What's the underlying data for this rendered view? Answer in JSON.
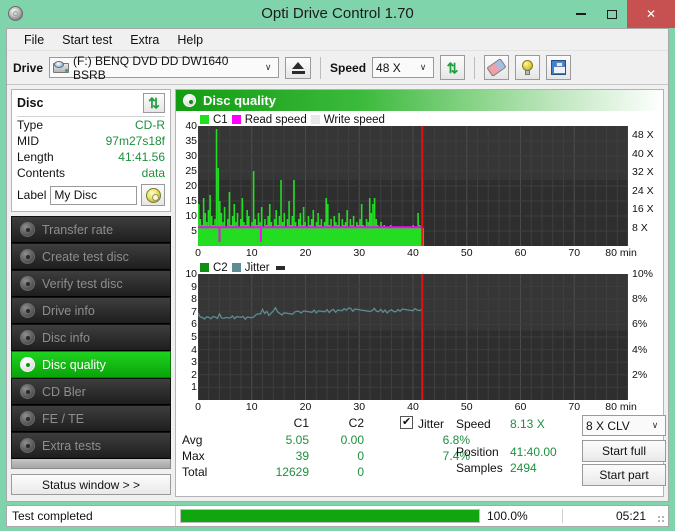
{
  "window": {
    "title": "Opti Drive Control 1.70",
    "icon": "cd-disc-icon",
    "controls": {
      "minimize": "–",
      "maximize": "□",
      "close": "✕"
    }
  },
  "menu": {
    "items": [
      "File",
      "Start test",
      "Extra",
      "Help"
    ]
  },
  "toolbar": {
    "drive_label": "Drive",
    "drive_value": "(F:)  BENQ DVD DD DW1640 BSRB",
    "eject_title": "Eject",
    "speed_label": "Speed",
    "speed_value": "48 X",
    "refresh_icon": "refresh-icon",
    "eraser_icon": "eraser-icon",
    "bulb_icon": "bulb-icon",
    "save_icon": "floppy-save-icon"
  },
  "disc_panel": {
    "title": "Disc",
    "refresh_icon": "refresh-icon",
    "rows": [
      {
        "key": "Type",
        "value": "CD-R"
      },
      {
        "key": "MID",
        "value": "97m27s18f"
      },
      {
        "key": "Length",
        "value": "41:41.56"
      },
      {
        "key": "Contents",
        "value": "data"
      }
    ],
    "label_key": "Label",
    "label_value": "My Disc",
    "label_button_icon": "cd-disc-icon"
  },
  "sidebar": {
    "items": [
      {
        "label": "Transfer rate",
        "active": false
      },
      {
        "label": "Create test disc",
        "active": false
      },
      {
        "label": "Verify test disc",
        "active": false
      },
      {
        "label": "Drive info",
        "active": false
      },
      {
        "label": "Disc info",
        "active": false
      },
      {
        "label": "Disc quality",
        "active": true
      },
      {
        "label": "CD Bler",
        "active": false
      },
      {
        "label": "FE / TE",
        "active": false
      },
      {
        "label": "Extra tests",
        "active": false
      }
    ],
    "status_window_button": "Status window > >"
  },
  "main": {
    "header_title": "Disc quality",
    "header_icon": "disc-quality-icon"
  },
  "stats": {
    "col_headers": [
      "C1",
      "C2"
    ],
    "row_labels": [
      "Avg",
      "Max",
      "Total"
    ],
    "c1": {
      "avg": "5.05",
      "max": "39",
      "total": "12629"
    },
    "c2": {
      "avg": "0.00",
      "max": "0",
      "total": "0"
    },
    "jitter_checkbox_checked": true,
    "jitter_label": "Jitter",
    "jitter_avg": "6.8%",
    "jitter_max": "7.4%",
    "speed_label": "Speed",
    "speed_value": "8.13 X",
    "position_label": "Position",
    "position_value": "41:40.00",
    "samples_label": "Samples",
    "samples_value": "2494",
    "write_strategy": "8 X CLV",
    "start_full_button": "Start full",
    "start_part_button": "Start part"
  },
  "statusbar": {
    "message": "Test completed",
    "progress_percent": "100.0%",
    "progress_value": 100,
    "elapsed": "05:21"
  },
  "colors": {
    "title_bar": "#7fd4ab",
    "close_button": "#c75050",
    "accent_green": "#0fa60f",
    "value_green": "#1f8f3f",
    "c1_green": "#22dd22",
    "read_speed_magenta": "#ff00ff",
    "write_speed_grey": "#e8e8e8",
    "c2_green": "#109010",
    "jitter_teal": "#5c8d92",
    "marker_red": "#ee1111",
    "plot_background": "#2b2b2b"
  },
  "chart_data": [
    {
      "type": "area",
      "name": "c1-error-chart",
      "title": "C1 errors / speed",
      "xlabel": "min",
      "ylabel": "C1",
      "xlim": [
        0,
        80
      ],
      "ylim": [
        0,
        40
      ],
      "xticks": [
        0,
        10,
        20,
        30,
        40,
        50,
        60,
        70,
        80
      ],
      "xticklabels": [
        "0",
        "10",
        "20",
        "30",
        "40",
        "50",
        "60",
        "70",
        "80 min"
      ],
      "yticks": [
        5,
        10,
        15,
        20,
        25,
        30,
        35,
        40
      ],
      "right_axis": {
        "label": "X",
        "ylim": [
          0,
          52
        ],
        "ticks": [
          8,
          16,
          24,
          32,
          40,
          48
        ],
        "ticklabels": [
          "8 X",
          "16 X",
          "24 X",
          "32 X",
          "40 X",
          "48 X"
        ]
      },
      "grid": true,
      "legend": [
        {
          "label": "C1",
          "color": "#22dd22"
        },
        {
          "label": "Read speed",
          "color": "#ff00ff"
        },
        {
          "label": "Write speed",
          "color": "#e8e8e8"
        }
      ],
      "data_end_x": 41.7,
      "marker_x": 41.7,
      "series": [
        {
          "name": "C1",
          "color": "#22dd22",
          "x": [
            0.0,
            0.3,
            0.6,
            0.9,
            1.2,
            1.5,
            1.8,
            2.1,
            2.4,
            2.7,
            3.0,
            3.3,
            3.6,
            3.9,
            4.2,
            4.5,
            4.8,
            5.1,
            5.4,
            5.7,
            6.0,
            6.3,
            6.6,
            6.9,
            7.2,
            7.5,
            7.8,
            8.1,
            8.4,
            8.7,
            9.0,
            9.3,
            9.6,
            9.9,
            10.2,
            10.5,
            10.8,
            11.1,
            11.4,
            11.7,
            12.0,
            12.3,
            12.6,
            12.9,
            13.2,
            13.5,
            13.8,
            14.1,
            14.4,
            14.7,
            15.0,
            15.3,
            15.6,
            15.9,
            16.2,
            16.5,
            16.8,
            17.1,
            17.4,
            17.7,
            18.0,
            18.3,
            18.6,
            18.9,
            19.2,
            19.5,
            19.8,
            20.1,
            20.4,
            20.7,
            21.0,
            21.3,
            21.6,
            21.9,
            22.2,
            22.5,
            22.8,
            23.1,
            23.4,
            23.7,
            24.0,
            24.3,
            24.6,
            24.9,
            25.2,
            25.5,
            25.8,
            26.1,
            26.4,
            26.7,
            27.0,
            27.3,
            27.6,
            27.9,
            28.2,
            28.5,
            28.8,
            29.1,
            29.4,
            29.7,
            30.0,
            30.3,
            30.6,
            30.9,
            31.2,
            31.5,
            31.8,
            32.1,
            32.4,
            32.7,
            33.0,
            33.3,
            33.6,
            33.9,
            34.2,
            34.5,
            34.8,
            35.1,
            35.4,
            35.7,
            36.0,
            36.3,
            36.6,
            36.9,
            37.2,
            37.5,
            37.8,
            38.1,
            38.4,
            38.7,
            39.0,
            39.3,
            39.6,
            39.9,
            40.2,
            40.5,
            40.8,
            41.1,
            41.4,
            41.7
          ],
          "values": [
            14,
            9,
            7,
            16,
            11,
            8,
            12,
            17,
            10,
            7,
            9,
            39,
            26,
            15,
            11,
            8,
            13,
            6,
            9,
            18,
            7,
            10,
            14,
            8,
            11,
            6,
            9,
            16,
            8,
            7,
            12,
            10,
            6,
            8,
            25,
            9,
            7,
            11,
            8,
            13,
            6,
            9,
            7,
            10,
            14,
            8,
            6,
            9,
            12,
            7,
            10,
            22,
            8,
            11,
            6,
            9,
            15,
            7,
            10,
            22,
            8,
            6,
            9,
            11,
            7,
            13,
            8,
            6,
            10,
            7,
            9,
            12,
            6,
            8,
            11,
            7,
            9,
            6,
            8,
            16,
            14,
            7,
            9,
            6,
            10,
            8,
            7,
            11,
            6,
            9,
            7,
            8,
            12,
            6,
            9,
            7,
            10,
            6,
            8,
            7,
            9,
            14,
            7,
            6,
            9,
            8,
            16,
            11,
            14,
            16,
            9,
            7,
            6,
            8,
            5,
            7,
            4,
            6,
            5,
            7,
            4,
            6,
            5,
            4,
            6,
            3,
            5,
            4,
            6,
            5,
            4,
            6,
            5,
            7,
            5,
            6,
            11,
            7,
            5,
            6
          ]
        },
        {
          "name": "Read speed",
          "color": "#ff00ff",
          "flat_value_x": 8.13,
          "note": "near-flat magenta line at ~8X with two dropouts near 4 min and 11.7 min"
        }
      ]
    },
    {
      "type": "line",
      "name": "c2-jitter-chart",
      "title": "C2 errors / jitter",
      "xlabel": "min",
      "ylabel": "C2",
      "xlim": [
        0,
        80
      ],
      "ylim": [
        0,
        10
      ],
      "xticks": [
        0,
        10,
        20,
        30,
        40,
        50,
        60,
        70,
        80
      ],
      "xticklabels": [
        "0",
        "10",
        "20",
        "30",
        "40",
        "50",
        "60",
        "70",
        "80 min"
      ],
      "yticks": [
        1,
        2,
        3,
        4,
        5,
        6,
        7,
        8,
        9,
        10
      ],
      "right_axis": {
        "ylim": [
          0,
          10
        ],
        "ticks": [
          2,
          4,
          6,
          8,
          10
        ],
        "ticklabels": [
          "2%",
          "4%",
          "6%",
          "8%",
          "10%"
        ]
      },
      "grid": true,
      "legend": [
        {
          "label": "C2",
          "color": "#109010"
        },
        {
          "label": "Jitter",
          "color": "#5c8d92"
        }
      ],
      "data_end_x": 41.7,
      "marker_x": 41.7,
      "series": [
        {
          "name": "Jitter",
          "color": "#5c8d92",
          "x": [
            0.0,
            0.4,
            0.8,
            1.2,
            1.6,
            2.0,
            2.4,
            2.8,
            3.2,
            3.6,
            4.0,
            4.4,
            4.8,
            5.2,
            5.6,
            6.0,
            6.4,
            6.8,
            7.2,
            7.6,
            8.0,
            8.4,
            8.8,
            9.2,
            9.6,
            10.0,
            10.4,
            10.8,
            11.2,
            11.6,
            12.0,
            12.4,
            12.8,
            13.2,
            13.6,
            14.0,
            14.4,
            14.8,
            15.2,
            15.6,
            16.0,
            16.4,
            16.8,
            17.2,
            17.6,
            18.0,
            18.4,
            18.8,
            19.2,
            19.6,
            20.0,
            20.4,
            20.8,
            21.2,
            21.6,
            22.0,
            22.4,
            22.8,
            23.2,
            23.6,
            24.0,
            24.4,
            24.8,
            25.2,
            25.6,
            26.0,
            26.4,
            26.8,
            27.2,
            27.6,
            28.0,
            28.4,
            28.8,
            29.2,
            29.6,
            30.0,
            30.4,
            30.8,
            31.2,
            31.6,
            32.0,
            32.4,
            32.8,
            33.2,
            33.6,
            34.0,
            34.4,
            34.8,
            35.2,
            35.6,
            36.0,
            36.4,
            36.8,
            37.2,
            37.6,
            38.0,
            38.4,
            38.8,
            39.2,
            39.6,
            40.0,
            40.4,
            40.8,
            41.2,
            41.7
          ],
          "values": [
            7.0,
            6.6,
            6.5,
            6.5,
            6.6,
            6.5,
            6.5,
            6.6,
            6.5,
            6.5,
            6.8,
            6.6,
            6.5,
            6.5,
            6.6,
            6.5,
            6.6,
            6.5,
            6.6,
            6.5,
            6.6,
            6.6,
            6.5,
            6.6,
            6.5,
            6.6,
            6.6,
            6.7,
            6.9,
            6.8,
            7.1,
            6.9,
            7.0,
            6.8,
            6.9,
            7.0,
            7.4,
            7.0,
            6.8,
            6.8,
            6.9,
            6.8,
            6.9,
            6.8,
            6.9,
            7.0,
            7.0,
            7.1,
            6.9,
            7.0,
            7.1,
            7.0,
            6.9,
            7.0,
            7.1,
            7.0,
            7.1,
            7.0,
            7.1,
            7.0,
            7.1,
            7.0,
            7.1,
            7.1,
            7.0,
            7.1,
            7.2,
            7.1,
            7.2,
            7.2,
            7.3,
            7.2,
            7.1,
            7.2,
            7.1,
            7.2,
            7.1,
            7.2,
            7.1,
            7.0,
            7.1,
            7.1,
            7.2,
            7.1,
            7.0,
            7.1,
            7.0,
            7.1,
            7.0,
            7.1,
            7.1,
            7.1,
            7.0,
            7.1,
            7.1,
            7.2,
            7.1,
            7.2,
            7.1,
            7.2,
            7.1,
            7.2,
            7.2,
            7.1,
            7.1
          ]
        },
        {
          "name": "C2",
          "color": "#109010",
          "values_all_zero": true
        }
      ]
    }
  ]
}
